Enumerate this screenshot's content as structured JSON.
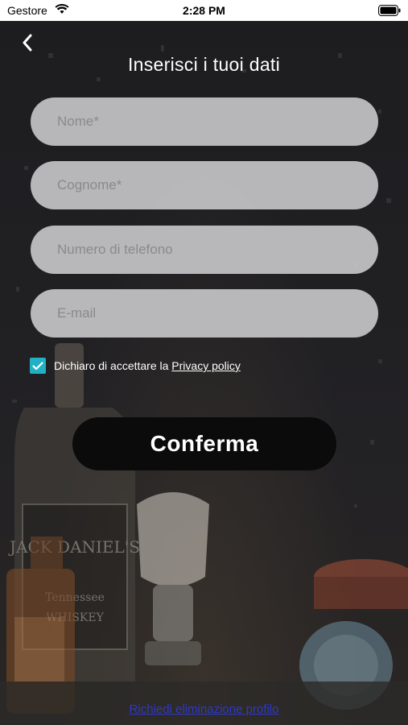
{
  "status_bar": {
    "carrier": "Gestore",
    "time": "2:28 PM"
  },
  "header": {
    "title": "Inserisci i tuoi dati",
    "back_icon": "chevron-left-icon"
  },
  "form": {
    "first_name": {
      "placeholder": "Nome*",
      "value": ""
    },
    "last_name": {
      "placeholder": "Cognome*",
      "value": ""
    },
    "phone": {
      "placeholder": "Numero di telefono",
      "value": ""
    },
    "email": {
      "placeholder": "E-mail",
      "value": ""
    },
    "privacy": {
      "checked": true,
      "text": "Dichiaro di accettare la",
      "link_label": "Privacy policy"
    },
    "submit_label": "Conferma"
  },
  "footer": {
    "delete_profile_label": "Richiedi eliminazione profilo"
  },
  "colors": {
    "accent_checkbox": "#21b1c4",
    "button_bg": "#0b0b0b",
    "field_bg": "#cdcdcf",
    "link_blue": "#2f38c8"
  }
}
